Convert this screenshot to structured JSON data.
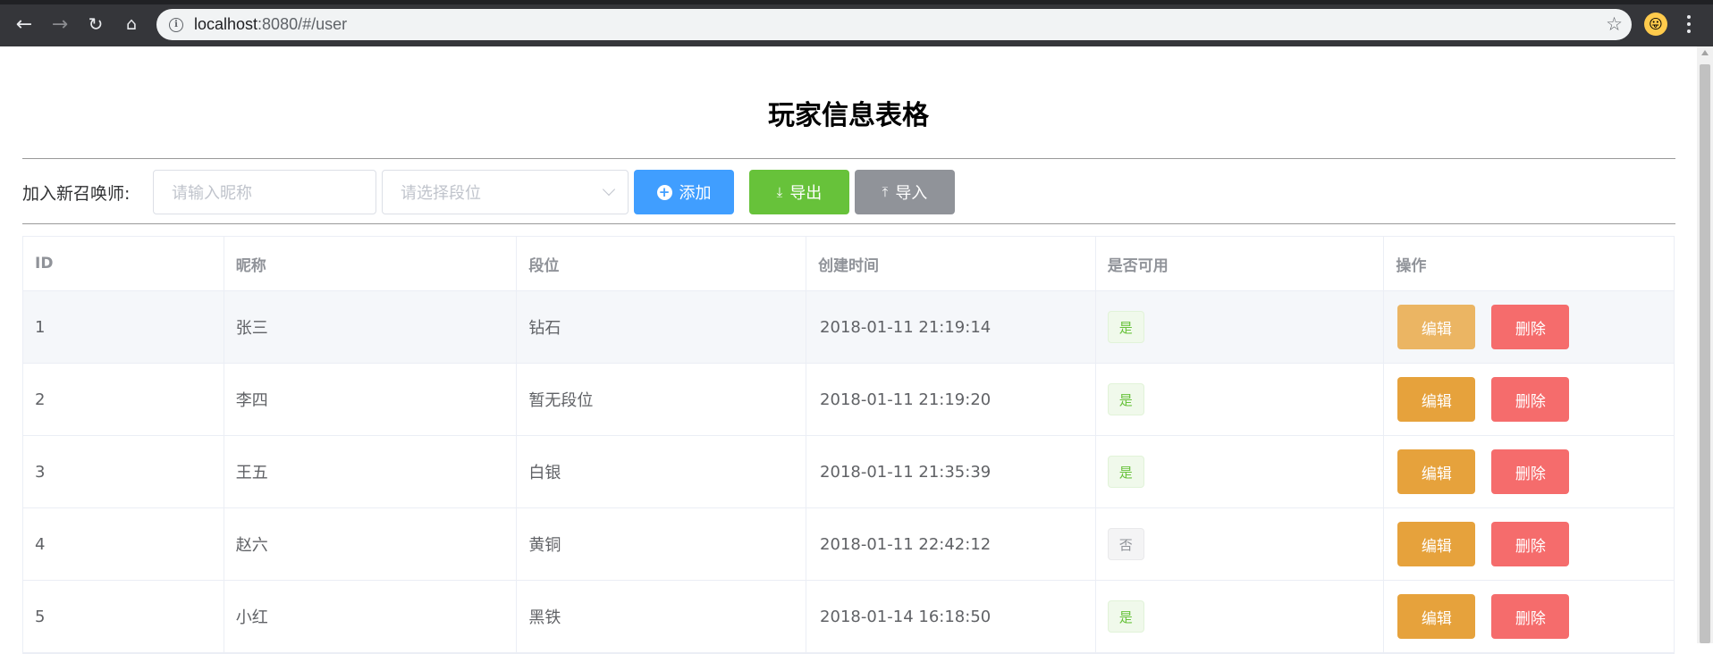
{
  "browser": {
    "url_host": "localhost",
    "url_rest": ":8080/#/user"
  },
  "page": {
    "title": "玩家信息表格"
  },
  "form": {
    "label": "加入新召唤师:",
    "nickname_placeholder": "请输入昵称",
    "rank_placeholder": "请选择段位",
    "add_label": "添加",
    "export_label": "导出",
    "import_label": "导入"
  },
  "table": {
    "columns": [
      "ID",
      "昵称",
      "段位",
      "创建时间",
      "是否可用",
      "操作"
    ],
    "edit_label": "编辑",
    "delete_label": "删除",
    "rows": [
      {
        "id": "1",
        "name": "张三",
        "rank": "钻石",
        "created": "2018-01-11 21:19:14",
        "enabled": "是"
      },
      {
        "id": "2",
        "name": "李四",
        "rank": "暂无段位",
        "created": "2018-01-11 21:19:20",
        "enabled": "是"
      },
      {
        "id": "3",
        "name": "王五",
        "rank": "白银",
        "created": "2018-01-11 21:35:39",
        "enabled": "是"
      },
      {
        "id": "4",
        "name": "赵六",
        "rank": "黄铜",
        "created": "2018-01-11 22:42:12",
        "enabled": "否"
      },
      {
        "id": "5",
        "name": "小红",
        "rank": "黑铁",
        "created": "2018-01-14 16:18:50",
        "enabled": "是"
      }
    ]
  },
  "colors": {
    "primary": "#409eff",
    "success": "#67c23a",
    "info": "#909399",
    "warning": "#e6a23c",
    "danger": "#f56c6c"
  }
}
